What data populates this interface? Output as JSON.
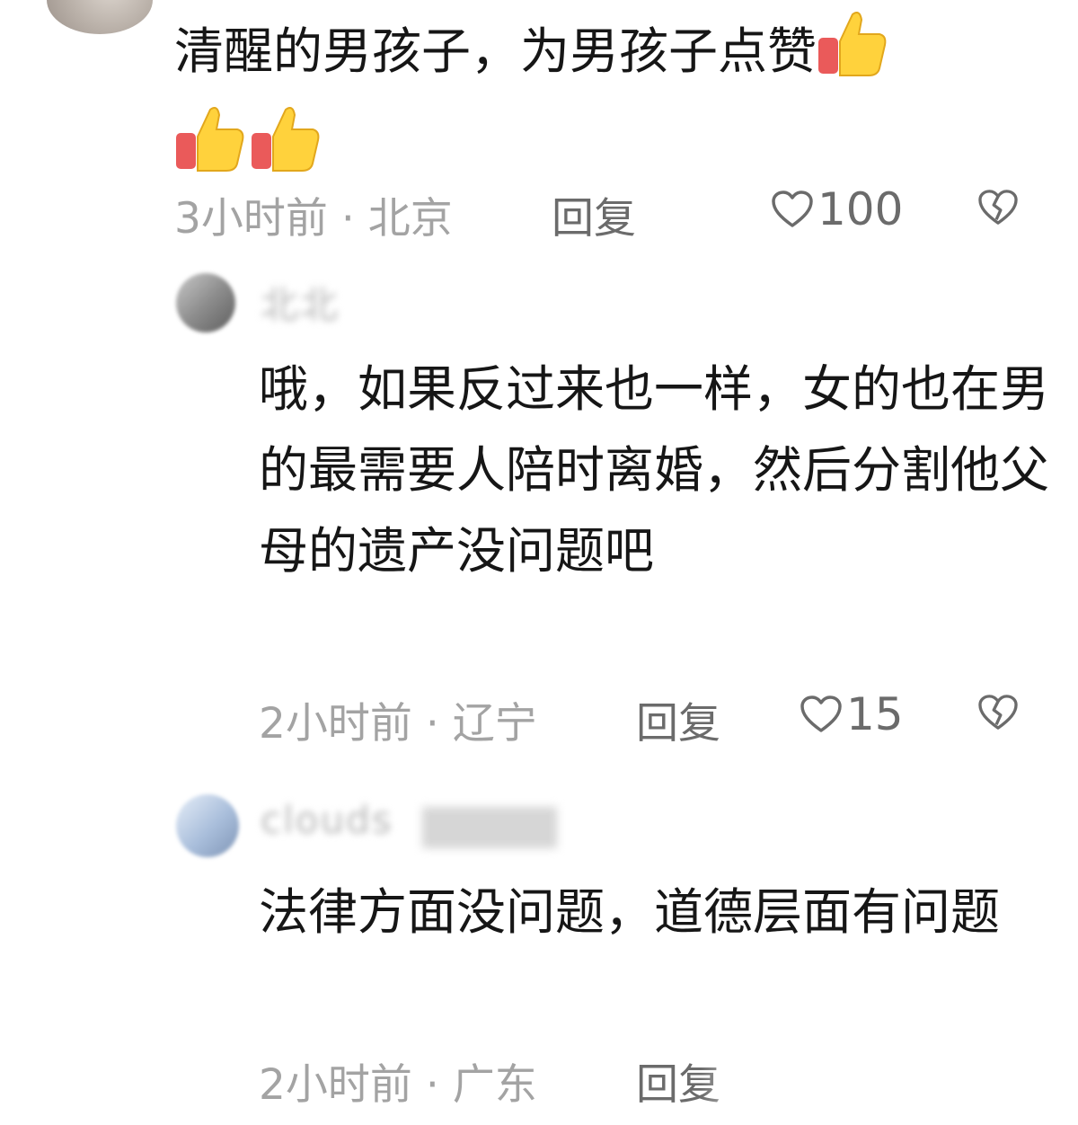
{
  "comments": [
    {
      "text_line1": "清醒的男孩子，为男孩子点赞",
      "emoji": "thumbs-up",
      "time": "3小时前",
      "location": "北京",
      "reply_label": "回复",
      "likes": "100"
    },
    {
      "username": "北北",
      "text": "哦，如果反过来也一样，女的也在男的最需要人陪时离婚，然后分割他父母的遗产没问题吧",
      "time": "2小时前",
      "location": "辽宁",
      "reply_label": "回复",
      "likes": "15"
    },
    {
      "username": "clouds",
      "text": "法律方面没问题，道德层面有问题",
      "time": "2小时前",
      "location": "广东",
      "reply_label": "回复"
    }
  ],
  "separator": " · ",
  "icons": {
    "like": "heart-outline-icon",
    "dislike": "broken-heart-icon",
    "emoji": "thumbs-up-emoji"
  },
  "colors": {
    "meta_text": "#a3a3a3",
    "reply_text": "#6b6b6b",
    "body_text": "#161616"
  }
}
